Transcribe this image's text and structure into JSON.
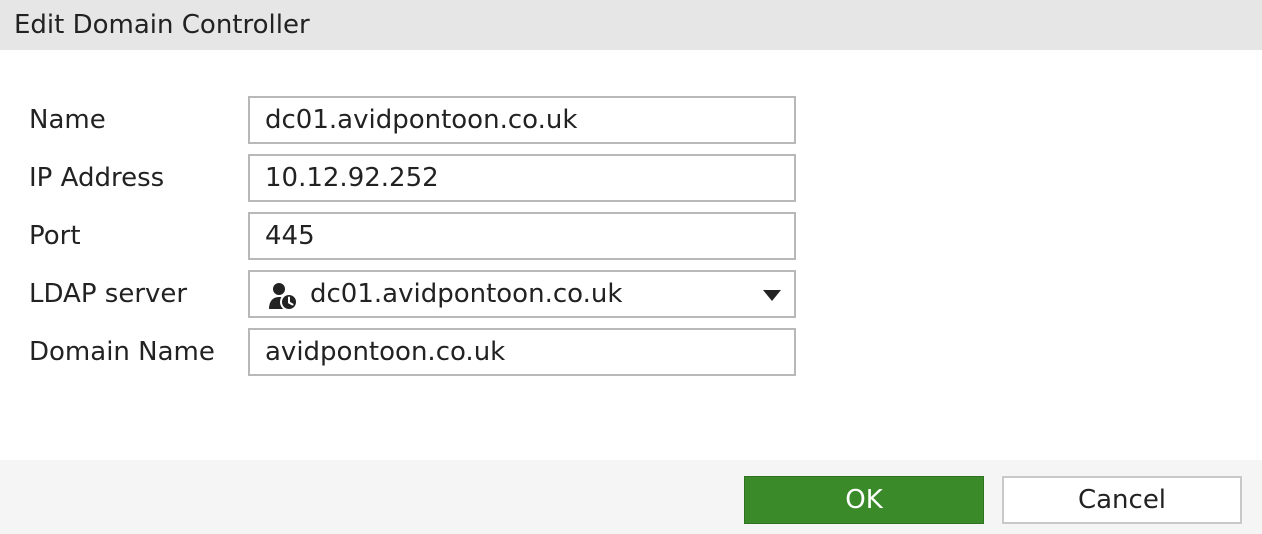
{
  "dialog": {
    "title": "Edit Domain Controller"
  },
  "form": {
    "name": {
      "label": "Name",
      "value": "dc01.avidpontoon.co.uk"
    },
    "ip_address": {
      "label": "IP Address",
      "value": "10.12.92.252"
    },
    "port": {
      "label": "Port",
      "value": "445"
    },
    "ldap_server": {
      "label": "LDAP server",
      "value": "dc01.avidpontoon.co.uk",
      "icon": "user-clock-icon"
    },
    "domain_name": {
      "label": "Domain Name",
      "value": "avidpontoon.co.uk"
    }
  },
  "buttons": {
    "ok_label": "OK",
    "cancel_label": "Cancel"
  },
  "colors": {
    "ok_button": "#3a8a2a",
    "header_bg": "#e6e6e6",
    "footer_bg": "#f5f5f5"
  }
}
